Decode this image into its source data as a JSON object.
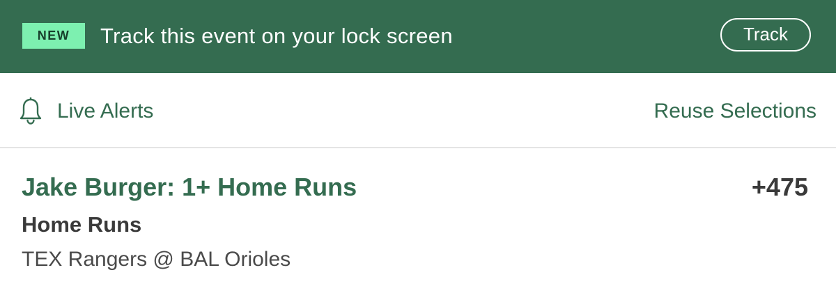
{
  "banner": {
    "badge": "NEW",
    "message": "Track this event on your lock screen",
    "track_label": "Track",
    "background_color": "#346c50",
    "badge_color": "#7df0b0"
  },
  "alerts_row": {
    "icon": "bell-icon",
    "live_alerts_label": "Live Alerts",
    "reuse_label": "Reuse Selections"
  },
  "bet": {
    "title": "Jake Burger: 1+ Home Runs",
    "odds": "+475",
    "market": "Home Runs",
    "matchup": "TEX Rangers @ BAL Orioles"
  }
}
